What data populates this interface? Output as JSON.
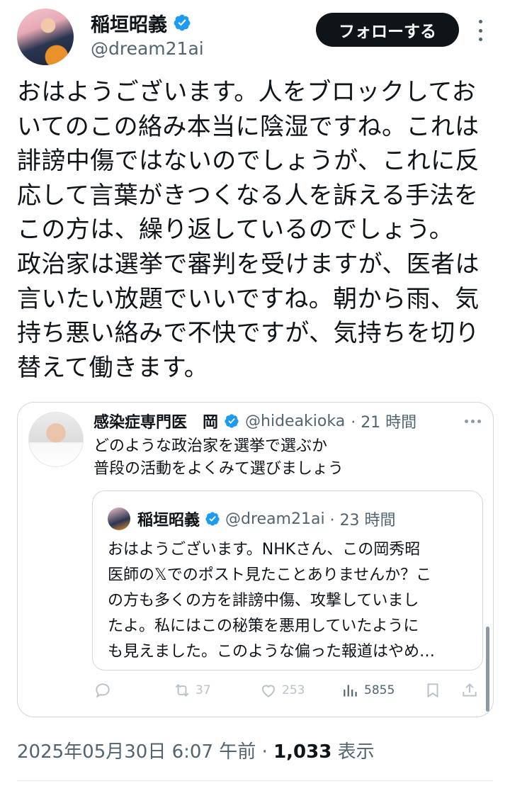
{
  "author": {
    "name": "稲垣昭義",
    "handle": "@dream21ai",
    "follow_label": "フォローする"
  },
  "post": {
    "text": "おはようございます。人をブロックしてお\nいてのこの絡み本当に陰湿ですね。これは\n誹謗中傷ではないのでしょうが、これに反\n応して言葉がきつくなる人を訴える手法を\nこの方は、繰り返しているのでしょう。\n政治家は選挙で審判を受けますが、医者は\n言いたい放題でいいですね。朝から雨、気\n持ち悪い絡みで不快ですが、気持ちを切り\n替えて働きます。"
  },
  "quote": {
    "name": "感染症専門医　岡",
    "handle": "@hideakioka",
    "time": "· 21 時間",
    "text": "どのような政治家を選挙で選ぶか\n普段の活動をよくみて選びましょう",
    "nested": {
      "name": "稲垣昭義",
      "handle": "@dream21ai",
      "time": "· 23 時間",
      "text": "おはようございます。NHKさん、この岡秀昭\n医師の𝕏でのポスト見たことありませんか？こ\nの方も多くの方を誹謗中傷、攻撃していまし\nたよ。私にはこの秘策を悪用していたように\nも見えました。このような偏った報道はやめ…"
    },
    "actions": {
      "retweets": "37",
      "likes": "253",
      "views": "5855"
    }
  },
  "footer": {
    "datetime": "2025年05月30日 6:07 午前",
    "separator": "·",
    "view_count": "1,033",
    "view_label": "表示"
  },
  "colors": {
    "verified": "#1d9bf0",
    "text": "#0f1419",
    "secondary": "#536471",
    "border": "#cfd9de"
  },
  "icons": [
    "verified-badge-icon",
    "more-icon",
    "reply-icon",
    "retweet-icon",
    "like-icon",
    "views-icon",
    "bookmark-icon",
    "share-icon"
  ]
}
